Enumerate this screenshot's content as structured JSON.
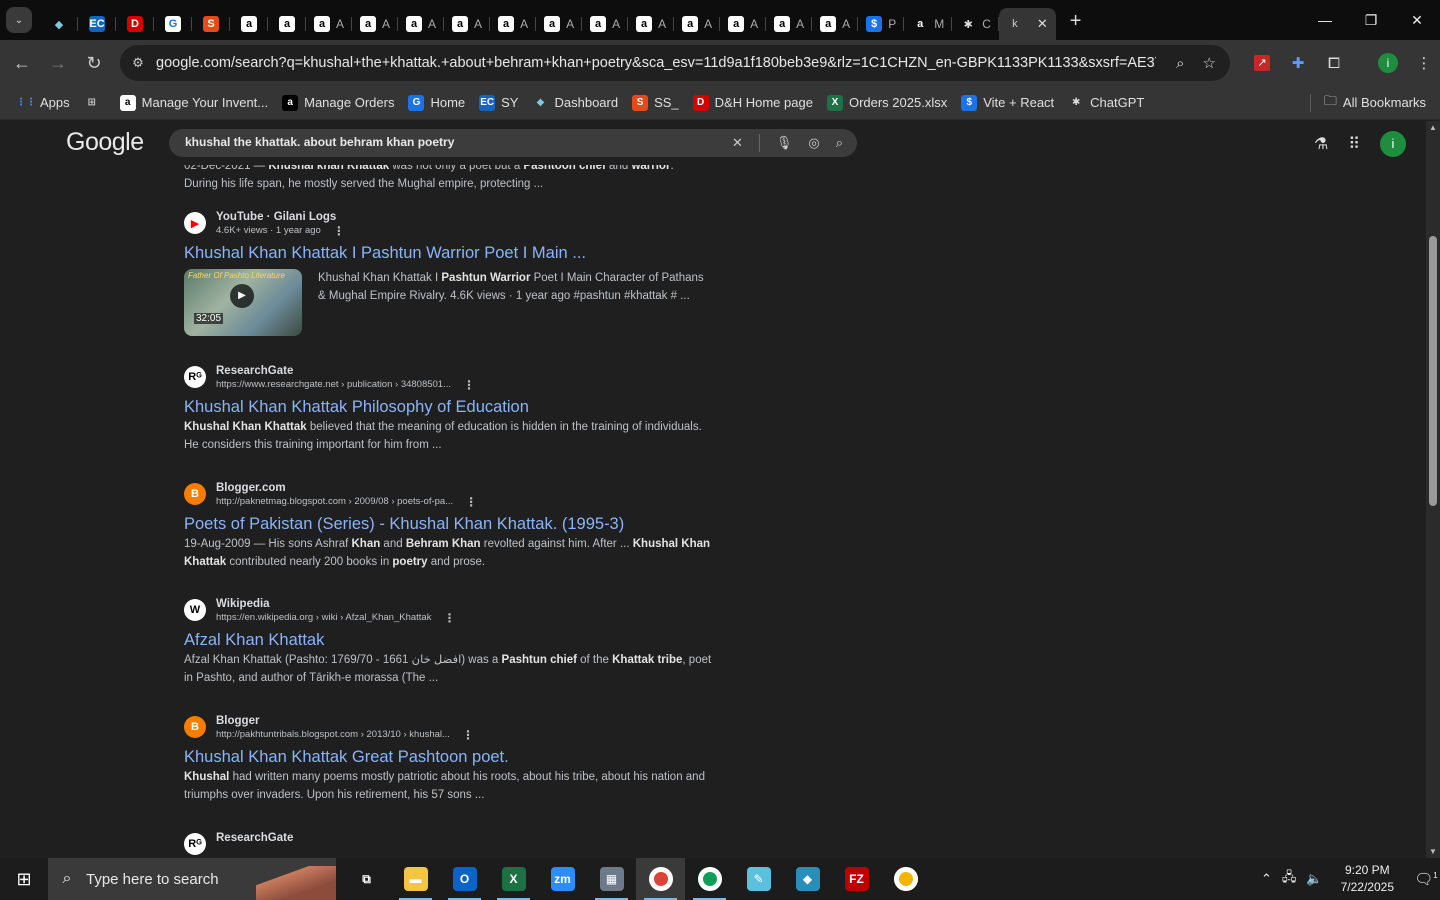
{
  "browser": {
    "tabs": [
      {
        "icon": "ring-icon",
        "letter": "◆",
        "bg": "#0d0d0d",
        "fg": "#7ec8e3",
        "label": ""
      },
      {
        "icon": "ec-icon",
        "letter": "EC",
        "bg": "#1565c0",
        "fg": "#ffffff",
        "label": ""
      },
      {
        "icon": "dh-icon",
        "letter": "D",
        "bg": "#d50000",
        "fg": "#ffffff",
        "label": ""
      },
      {
        "icon": "google-doc-icon",
        "letter": "G",
        "bg": "#ffffff",
        "fg": "#1a73e8",
        "label": ""
      },
      {
        "icon": "ss-icon",
        "letter": "S",
        "bg": "#e64a19",
        "fg": "#ffffff",
        "label": ""
      },
      {
        "icon": "amazon-icon",
        "letter": "a",
        "bg": "#ffffff",
        "fg": "#000000",
        "label": ""
      },
      {
        "icon": "amazon-icon",
        "letter": "a",
        "bg": "#ffffff",
        "fg": "#000000",
        "label": ""
      },
      {
        "icon": "amazon-icon",
        "letter": "a",
        "bg": "#ffffff",
        "fg": "#000000",
        "label": "A"
      },
      {
        "icon": "amazon-icon",
        "letter": "a",
        "bg": "#ffffff",
        "fg": "#000000",
        "label": "A"
      },
      {
        "icon": "amazon-icon",
        "letter": "a",
        "bg": "#ffffff",
        "fg": "#000000",
        "label": "A"
      },
      {
        "icon": "amazon-icon",
        "letter": "a",
        "bg": "#ffffff",
        "fg": "#000000",
        "label": "A"
      },
      {
        "icon": "amazon-icon",
        "letter": "a",
        "bg": "#ffffff",
        "fg": "#000000",
        "label": "A"
      },
      {
        "icon": "amazon-icon",
        "letter": "a",
        "bg": "#ffffff",
        "fg": "#000000",
        "label": "A"
      },
      {
        "icon": "amazon-icon",
        "letter": "a",
        "bg": "#ffffff",
        "fg": "#000000",
        "label": "A"
      },
      {
        "icon": "amazon-icon",
        "letter": "a",
        "bg": "#ffffff",
        "fg": "#000000",
        "label": "A"
      },
      {
        "icon": "amazon-icon",
        "letter": "a",
        "bg": "#ffffff",
        "fg": "#000000",
        "label": "A"
      },
      {
        "icon": "amazon-icon",
        "letter": "a",
        "bg": "#ffffff",
        "fg": "#000000",
        "label": "A"
      },
      {
        "icon": "amazon-icon",
        "letter": "a",
        "bg": "#ffffff",
        "fg": "#000000",
        "label": "A"
      },
      {
        "icon": "amazon-icon",
        "letter": "a",
        "bg": "#ffffff",
        "fg": "#000000",
        "label": "A"
      },
      {
        "icon": "dollar-icon",
        "letter": "$",
        "bg": "#1a73e8",
        "fg": "#ffffff",
        "label": "P"
      },
      {
        "icon": "amazon-icon",
        "letter": "a",
        "bg": "#0d0d0d",
        "fg": "#ffffff",
        "label": "M"
      },
      {
        "icon": "chatgpt-icon",
        "letter": "✱",
        "bg": "#0d0d0d",
        "fg": "#dddddd",
        "label": "C"
      }
    ],
    "active_tab": {
      "letter": "k",
      "close": "✕"
    },
    "new_tab": "+",
    "window_controls": {
      "minimize": "—",
      "restore": "❐",
      "close": "✕"
    },
    "url": "google.com/search?q=khushal+the+khattak.+about+behram+khan+poetry&sca_esv=11d9a1f180beb3e9&rlz=1C1CHZN_en-GBPK1133PK1133&sxsrf=AE3TifP...",
    "bookmarks": [
      {
        "label": "Apps",
        "icon": "apps-grid-icon",
        "letter": "⋮⋮",
        "bg": "transparent",
        "fg": "#4285f4"
      },
      {
        "label": "",
        "icon": "tab-groups-icon",
        "letter": "⊞",
        "bg": "transparent",
        "fg": "#cccccc"
      },
      {
        "label": "Manage Your Invent...",
        "icon": "amazon-icon",
        "letter": "a",
        "bg": "#ffffff",
        "fg": "#000000"
      },
      {
        "label": "Manage Orders",
        "icon": "amazon-icon",
        "letter": "a",
        "bg": "#000000",
        "fg": "#ffffff"
      },
      {
        "label": "Home",
        "icon": "google-doc-icon",
        "letter": "G",
        "bg": "#1a73e8",
        "fg": "#ffffff"
      },
      {
        "label": "SY",
        "icon": "ec-icon",
        "letter": "EC",
        "bg": "#1565c0",
        "fg": "#ffffff"
      },
      {
        "label": "Dashboard",
        "icon": "ring-icon",
        "letter": "◆",
        "bg": "transparent",
        "fg": "#7ec8e3"
      },
      {
        "label": "SS_",
        "icon": "ss-icon",
        "letter": "S",
        "bg": "#e64a19",
        "fg": "#ffffff"
      },
      {
        "label": "D&H Home page",
        "icon": "dh-icon",
        "letter": "D",
        "bg": "#d50000",
        "fg": "#ffffff"
      },
      {
        "label": "Orders 2025.xlsx",
        "icon": "excel-icon",
        "letter": "X",
        "bg": "#1e7145",
        "fg": "#ffffff"
      },
      {
        "label": "Vite + React",
        "icon": "dollar-icon",
        "letter": "$",
        "bg": "#1a73e8",
        "fg": "#ffffff"
      },
      {
        "label": "ChatGPT",
        "icon": "chatgpt-icon",
        "letter": "✱",
        "bg": "transparent",
        "fg": "#dddddd"
      }
    ],
    "all_bookmarks": "All Bookmarks"
  },
  "google": {
    "logo": "Google",
    "query": "khushal the khattak. about behram khan poetry",
    "top_snippet": {
      "date": "02-Dec-2021",
      "html": "<b>Khushal khan Khattak</b> was not only a poet but a <b>Pashtoon chief</b> and <b>warrior</b>.<br>During his life span, he mostly served the Mughal empire, protecting ..."
    },
    "results": [
      {
        "source": "YouTube · Gilani Logs",
        "url": "4.6K+ views · 1 year ago",
        "icon_letter": "▶",
        "icon_bg": "#ffffff",
        "icon_fg": "#ff0000",
        "title": "Khushal Khan Khattak I Pashtun Warrior Poet I Main ...",
        "video": true,
        "thumb_label": "Father Of Pashto Literature",
        "duration": "32:05",
        "snippet": "Khushal Khan Khattak I <b>Pashtun Warrior</b> Poet I Main Character of Pathans & Mughal Empire Rivalry. 4.6K views · 1 year ago #pashtun #khattak # ..."
      },
      {
        "source": "ResearchGate",
        "url": "https://www.researchgate.net › publication › 34808501...",
        "icon_letter": "Rᴳ",
        "icon_bg": "#ffffff",
        "icon_fg": "#000000",
        "title": "Khushal Khan Khattak Philosophy of Education",
        "snippet": "<b>Khushal Khan Khattak</b> believed that the meaning of education is hidden in the training of individuals. He considers this training important for him from ..."
      },
      {
        "source": "Blogger.com",
        "url": "http://paknetmag.blogspot.com › 2009/08 › poets-of-pa...",
        "icon_letter": "B",
        "icon_bg": "#f57d00",
        "icon_fg": "#ffffff",
        "title": "Poets of Pakistan (Series) - Khushal Khan Khattak. (1995-3)",
        "snippet": "<span>19-Aug-2009</span> — His sons Ashraf <b>Khan</b> and <b>Behram Khan</b> revolted against him. After ... <b>Khushal Khan Khattak</b> contributed nearly 200 books in <b>poetry</b> and prose."
      },
      {
        "source": "Wikipedia",
        "url": "https://en.wikipedia.org › wiki › Afzal_Khan_Khattak",
        "icon_letter": "W",
        "icon_bg": "#ffffff",
        "icon_fg": "#000000",
        "title": "Afzal Khan Khattak",
        "snippet": "Afzal Khan Khattak (Pashto: افضل خان 1661 - 1769/70) was a <b>Pashtun chief</b> of the <b>Khattak tribe</b>, poet in Pashto, and author of Tārikh-e morassa (The ..."
      },
      {
        "source": "Blogger",
        "url": "http://pakhtuntribals.blogspot.com › 2013/10 › khushal...",
        "icon_letter": "B",
        "icon_bg": "#f57d00",
        "icon_fg": "#ffffff",
        "title": "Khushal Khan Khattak Great Pashtoon poet.",
        "snippet": "<b>Khushal</b> had written many poems mostly patriotic about his roots, about his tribe, about his nation and triumphs over invaders. Upon his retirement, his 57 sons ..."
      },
      {
        "source": "ResearchGate",
        "url": "",
        "icon_letter": "Rᴳ",
        "icon_bg": "#ffffff",
        "icon_fg": "#000000",
        "title": "",
        "snippet": ""
      }
    ]
  },
  "taskbar": {
    "search_placeholder": "Type here to search",
    "apps": [
      {
        "name": "task-view-icon",
        "letter": "⧉",
        "bg": "transparent",
        "on": false
      },
      {
        "name": "file-explorer-icon",
        "letter": "▬",
        "bg": "#f4c542",
        "on": true
      },
      {
        "name": "outlook-icon",
        "letter": "O",
        "bg": "#0a64c8",
        "on": true
      },
      {
        "name": "excel-icon",
        "letter": "X",
        "bg": "#1e7145",
        "on": true
      },
      {
        "name": "zoom-icon",
        "letter": "zm",
        "bg": "#2d8cff",
        "on": false
      },
      {
        "name": "calculator-icon",
        "letter": "▦",
        "bg": "#6c7a89",
        "on": true
      },
      {
        "name": "chrome-icon",
        "letter": "●",
        "bg": "#db4437",
        "on": true,
        "cur": true
      },
      {
        "name": "chrome-profile-icon",
        "letter": "●",
        "bg": "#0f9d58",
        "on": true
      },
      {
        "name": "notes-icon",
        "letter": "✎",
        "bg": "#5bc0de",
        "on": false
      },
      {
        "name": "app-diamond-icon",
        "letter": "◆",
        "bg": "#2a8fb8",
        "on": false
      },
      {
        "name": "filezilla-icon",
        "letter": "FZ",
        "bg": "#bf0000",
        "on": false
      },
      {
        "name": "chrome-alt-icon",
        "letter": "●",
        "bg": "#f4b400",
        "on": false
      }
    ],
    "time": "9:20 PM",
    "date": "7/22/2025",
    "notifications": "1"
  }
}
